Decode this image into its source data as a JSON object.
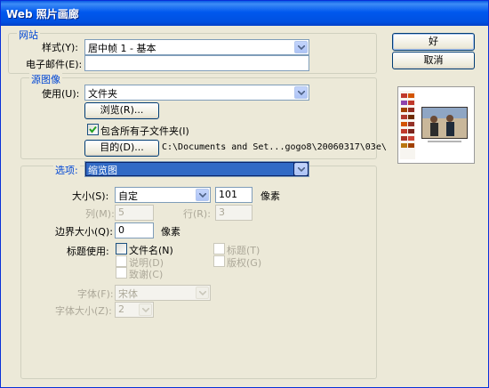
{
  "window": {
    "title": "Web 照片画廊"
  },
  "site": {
    "group_label": "网站",
    "style_label": "样式(Y):",
    "style_value": "居中帧 1 - 基本",
    "email_label": "电子邮件(E):",
    "email_value": ""
  },
  "source": {
    "group_label": "源图像",
    "use_label": "使用(U):",
    "use_value": "文件夹",
    "browse_label": "浏览(R)...",
    "include_subfolders_label": "包含所有子文件夹(I)",
    "include_subfolders_checked": true,
    "destination_label": "目的(D)...",
    "destination_path": "C:\\Documents and Set...gogo8\\20060317\\03e\\"
  },
  "options": {
    "label": "选项:",
    "value": "缩览图",
    "size_label": "大小(S):",
    "size_value": "自定",
    "size_px_value": "101",
    "size_px_unit": "像素",
    "columns_label": "列(M):",
    "columns_value": "5",
    "rows_label": "行(R):",
    "rows_value": "3",
    "border_label": "边界大小(Q):",
    "border_value": "0",
    "border_unit": "像素",
    "titles_use_label": "标题使用:",
    "filename_label": "文件名(N)",
    "caption_label": "说明(D)",
    "credits_label": "致谢(C)",
    "title_label": "标题(T)",
    "copyright_label": "版权(G)",
    "font_label": "字体(F):",
    "font_value": "宋体",
    "font_size_label": "字体大小(Z):",
    "font_size_value": "2"
  },
  "buttons": {
    "ok": "好",
    "cancel": "取消"
  }
}
